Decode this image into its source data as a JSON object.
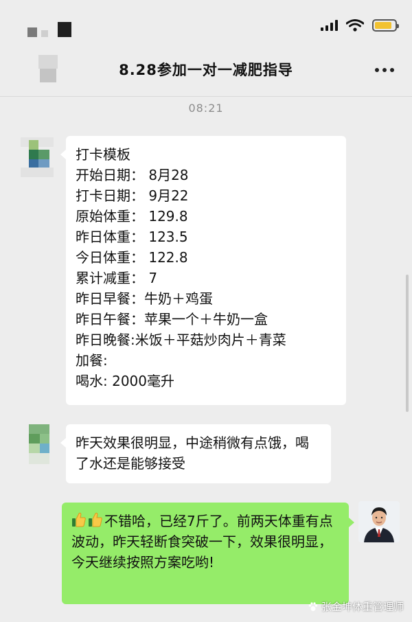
{
  "chat": {
    "title": "8.28参加一对一减肥指导",
    "timestamp": "08:21"
  },
  "messages": {
    "checkin": {
      "lines": [
        "打卡模板",
        "开始日期：  8月28",
        "打卡日期：  9月22",
        "原始体重：  129.8",
        "昨日体重：  123.5",
        "今日体重：  122.8",
        "累计减重：  7",
        "昨日早餐：牛奶＋鸡蛋",
        "昨日午餐：苹果一个＋牛奶一盒",
        "昨日晚餐:米饭＋平菇炒肉片＋青菜",
        "加餐:",
        "喝水: 2000毫升"
      ]
    },
    "feedback": {
      "text": "昨天效果很明显，中途稍微有点饿，喝了水还是能够接受"
    },
    "reply": {
      "text": "不错哈，已经7斤了。前两天体重有点波动，昨天轻断食突破一下，效果很明显，今天继续按照方案吃哟!",
      "emoji": [
        "thumbs-up-icon",
        "thumbs-up-icon"
      ]
    }
  },
  "watermark": {
    "text": "张金坤体重管理师"
  },
  "colors": {
    "background": "#ededed",
    "incoming_bubble": "#ffffff",
    "outgoing_bubble": "#95ec69",
    "battery": "#f2c230"
  }
}
